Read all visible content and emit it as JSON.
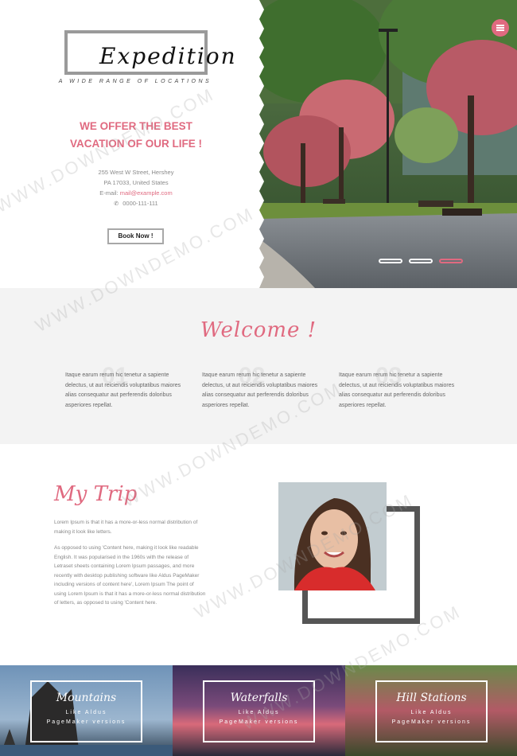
{
  "hero": {
    "logo": "Expedition",
    "tagline": "A WIDE RANGE OF LOCATIONS",
    "headline_line1": "WE OFFER THE BEST",
    "headline_line2": "VACATION OF OUR LIFE !",
    "address_line1": "255 West W Street, Hershey",
    "address_line2": "PA 17033, United States",
    "email_label": "E-mail:",
    "email": "mail@example.com",
    "phone": "0000-111-111",
    "book_label": "Book Now !",
    "slides": 3,
    "active_slide": 3
  },
  "welcome": {
    "title": "Welcome !",
    "features": [
      {
        "num": "01",
        "text": "Itaque earum rerum hic tenetur a sapiente delectus, ut aut reiciendis voluptatibus maiores alias consequatur aut perferendis doloribus asperiores repellat."
      },
      {
        "num": "02",
        "text": "Itaque earum rerum hic tenetur a sapiente delectus, ut aut reiciendis voluptatibus maiores alias consequatur aut perferendis doloribus asperiores repellat."
      },
      {
        "num": "03",
        "text": "Itaque earum rerum hic tenetur a sapiente delectus, ut aut reiciendis voluptatibus maiores alias consequatur aut perferendis doloribus asperiores repellat."
      }
    ]
  },
  "trip": {
    "title": "My Trip",
    "para1": "Lorem Ipsum is that it has a more-or-less normal distribution of making it look like letters.",
    "para2": "As opposed to using 'Content here, making it look like readable English. It was popularised in the 1960s with the release of Letraset sheets containing Lorem Ipsum passages, and more recently with desktop publishing software like Aldus PageMaker including versions of content here', Lorem Ipsum The point of using Lorem Ipsum is that it has a more-or-less normal distribution of letters, as opposed to using 'Content here."
  },
  "tiles": [
    {
      "title": "Mountains",
      "line1": "Like Aldus",
      "line2": "PageMaker versions"
    },
    {
      "title": "Waterfalls",
      "line1": "Like Aldus",
      "line2": "PageMaker versions"
    },
    {
      "title": "Hill Stations",
      "line1": "Like Aldus",
      "line2": "PageMaker versions"
    }
  ],
  "watermark": "WWW.DOWNDEMO.COM",
  "colors": {
    "accent": "#e06a80",
    "frame": "#555555",
    "section_bg": "#f3f3f3"
  }
}
